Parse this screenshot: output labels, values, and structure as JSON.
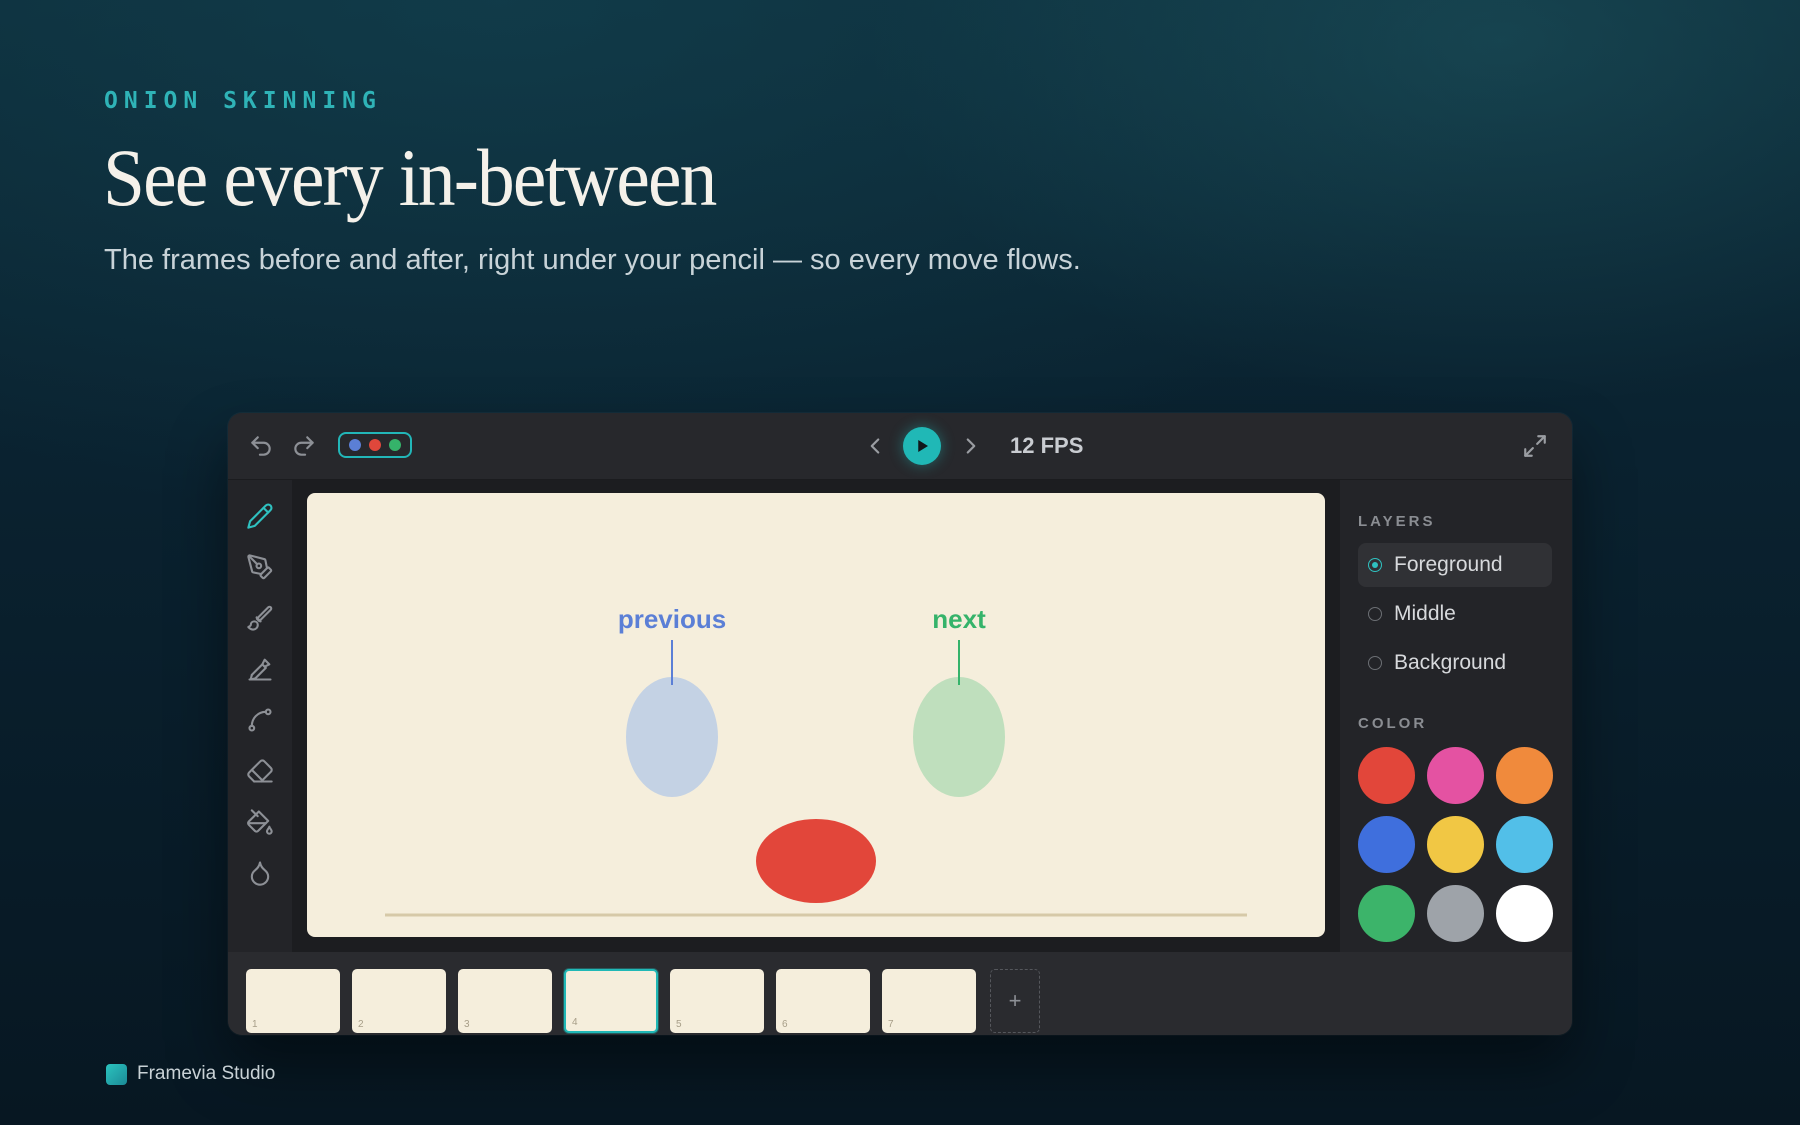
{
  "hero": {
    "eyebrow": "ONION SKINNING",
    "headline": "See every in-between",
    "subline": "The frames before and after, right under your pencil — so every move flows."
  },
  "toolbar": {
    "fps": "12 FPS",
    "undo_icon": "undo-icon",
    "redo_icon": "redo-icon",
    "onion_colors": [
      "#5b7fd6",
      "#e0473b",
      "#35b36a"
    ],
    "accent": "#20b8b6"
  },
  "tools": [
    "pencil-icon",
    "pen-icon",
    "brush-icon",
    "calligraphy-icon",
    "curve-icon",
    "eraser-icon",
    "fill-icon",
    "ink-drop-icon"
  ],
  "canvas": {
    "previous_label": "previous",
    "next_label": "next",
    "previous_color": "#5b7fd6",
    "next_color": "#35b36a",
    "current_color": "#e0473b"
  },
  "panel": {
    "layers_title": "LAYERS",
    "layers": [
      {
        "label": "Foreground",
        "active": true
      },
      {
        "label": "Middle",
        "active": false
      },
      {
        "label": "Background",
        "active": false
      }
    ],
    "color_title": "COLOR",
    "colors": [
      "#e2463a",
      "#e452a2",
      "#f08a3c",
      "#3f6fdd",
      "#f1c744",
      "#52bfe8",
      "#3cb46a",
      "#9ea3a9",
      "#ffffff"
    ]
  },
  "timeline": {
    "frames": [
      "1",
      "2",
      "3",
      "4",
      "5",
      "6",
      "7"
    ],
    "active_frame": "4",
    "add_label": "+"
  },
  "brand": {
    "name": "Framevia Studio"
  }
}
